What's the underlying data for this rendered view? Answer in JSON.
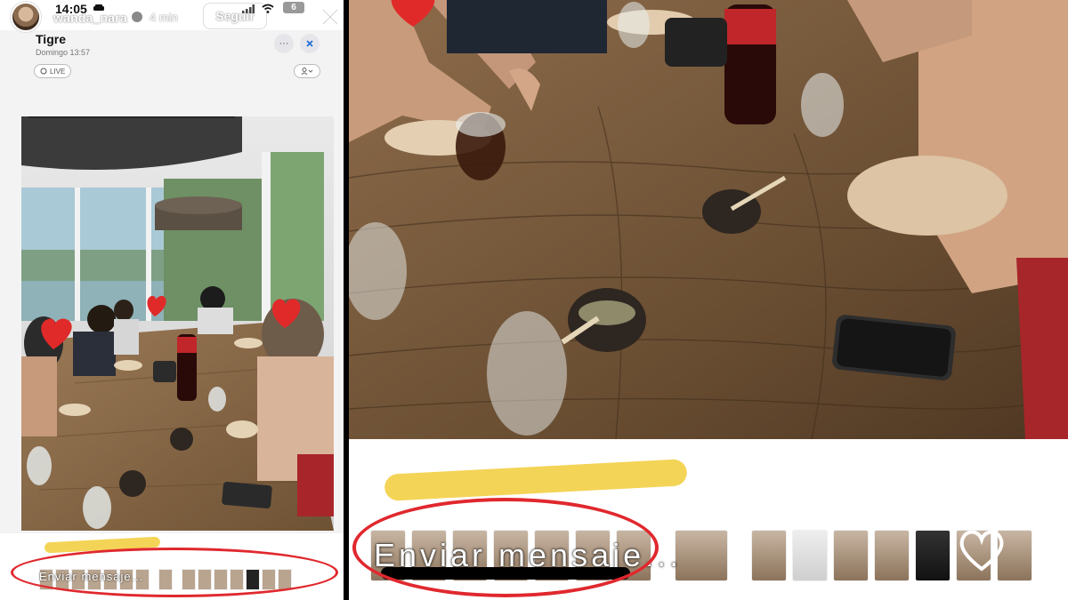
{
  "story": {
    "time": "14:05",
    "username": "wanda_nara",
    "posted_ago": "4 min",
    "follow_label": "Seguir",
    "battery": "6",
    "event_title": "Tigre",
    "event_date": "Domingo  13:57",
    "live_label": "LIVE",
    "more_label": "···",
    "message_placeholder": "Enviar mensaje..."
  },
  "zoom": {
    "message_placeholder": "Enviar mensaje..."
  },
  "colors": {
    "annotation_red": "#e0282e",
    "highlight_yellow": "#f2cc3a",
    "heart_red": "#e02a2a"
  },
  "icons": [
    "car-icon",
    "verified-icon",
    "signal-icon",
    "wifi-icon",
    "battery-icon",
    "close-icon",
    "more-icon",
    "person-icon",
    "heart-icon"
  ]
}
